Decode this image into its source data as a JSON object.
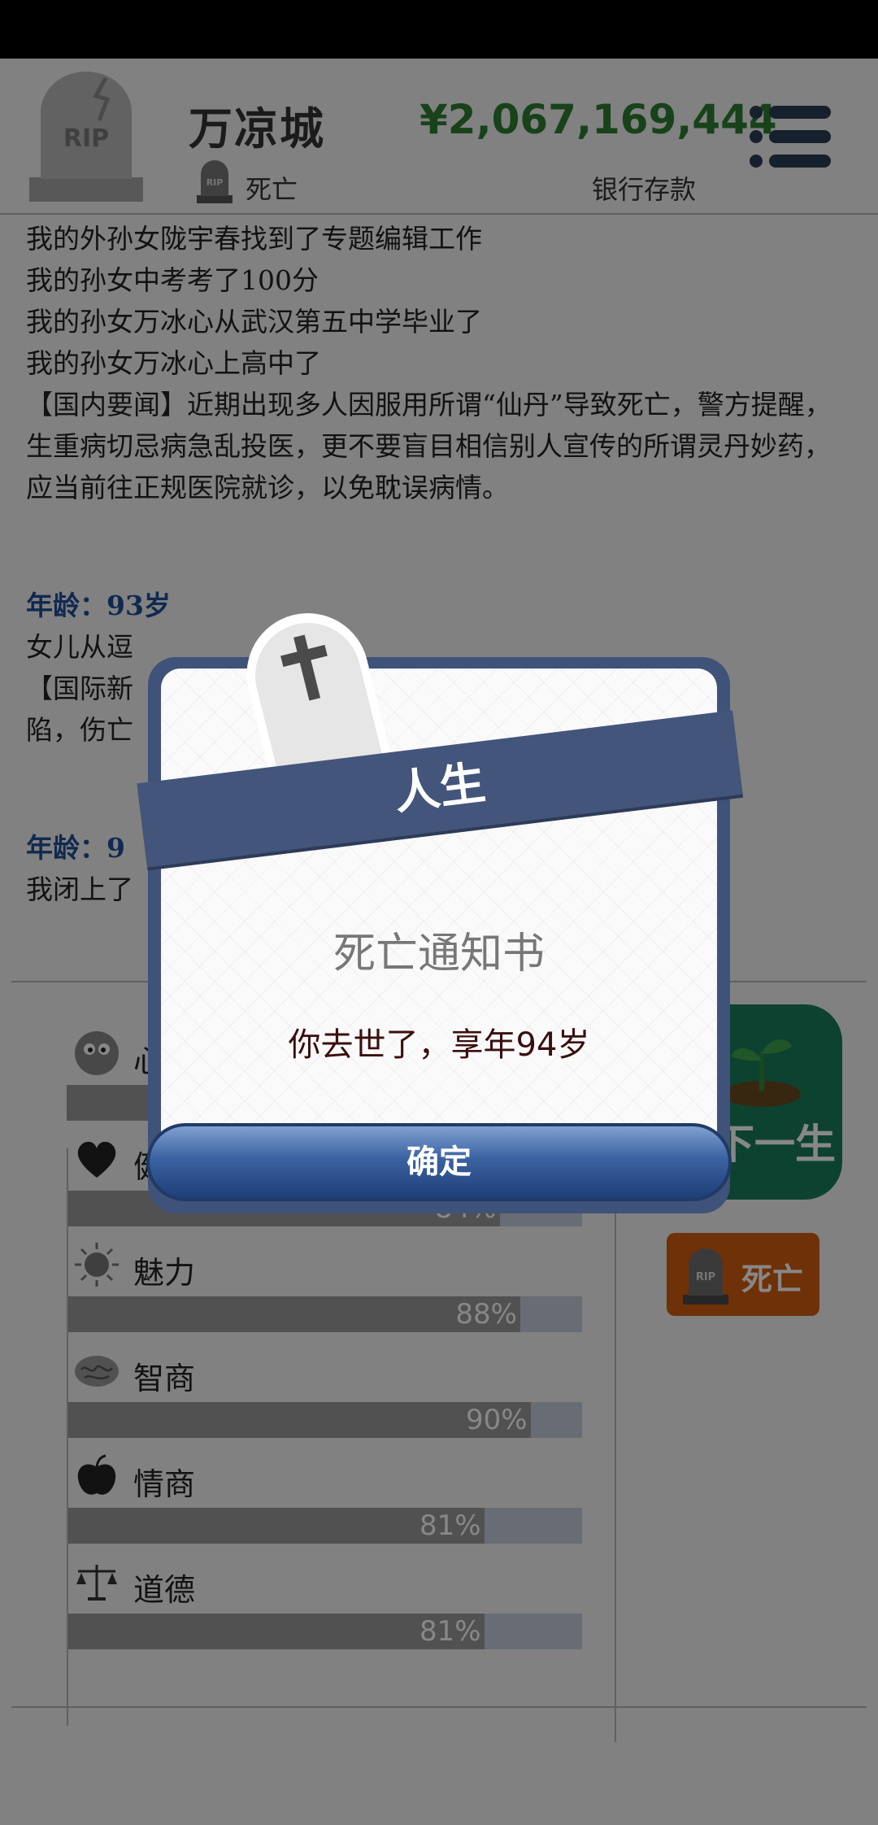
{
  "header": {
    "player_name": "万凉城",
    "status": "死亡",
    "money": "¥2,067,169,444",
    "money_label": "银行存款",
    "tombstone_text": "RIP"
  },
  "log": [
    {
      "type": "text",
      "text": "我的外孙女陇宇春找到了专题编辑工作"
    },
    {
      "type": "text",
      "text": "我的孙女中考考了100分"
    },
    {
      "type": "text",
      "text": "我的孙女万冰心从武汉第五中学毕业了"
    },
    {
      "type": "text",
      "text": "我的孙女万冰心上高中了"
    },
    {
      "type": "text",
      "text": "【国内要闻】近期出现多人因服用所谓“仙丹”导致死亡，警方提醒，生重病切忌病急乱投医，更不要盲目相信别人宣传的所谓灵丹妙药，应当前往正规医院就诊，以免耽误病情。"
    },
    {
      "type": "gap"
    },
    {
      "type": "age",
      "text": "年龄：93岁"
    },
    {
      "type": "text",
      "text": "女儿从逗"
    },
    {
      "type": "text",
      "text": "【国际新"
    },
    {
      "type": "text",
      "text": "陷，伤亡"
    },
    {
      "type": "gap"
    },
    {
      "type": "age",
      "text": "年龄：9"
    },
    {
      "type": "text",
      "text": "我闭上了"
    }
  ],
  "stats": [
    {
      "label": "心",
      "percent": 100,
      "icon": "smiley-face-icon"
    },
    {
      "label": "健",
      "percent": 84,
      "pct_text": "84%",
      "icon": "heart-icon"
    },
    {
      "label": "魅力",
      "percent": 88,
      "pct_text": "88%",
      "icon": "sun-icon"
    },
    {
      "label": "智商",
      "percent": 90,
      "pct_text": "90%",
      "icon": "brain-icon"
    },
    {
      "label": "情商",
      "percent": 81,
      "pct_text": "81%",
      "icon": "apple-icon"
    },
    {
      "label": "道德",
      "percent": 81,
      "pct_text": "81%",
      "icon": "scales-icon"
    }
  ],
  "side": {
    "next_life_label": "下一生",
    "death_label": "死亡"
  },
  "dialog": {
    "ribbon_title": "人生",
    "heading": "死亡通知书",
    "message": "你去世了，享年94岁",
    "confirm_label": "确定"
  },
  "colors": {
    "money_green": "#2e7d32",
    "age_blue": "#1f4f96",
    "next_button": "#1c7d5c",
    "death_badge": "#d15d10",
    "dialog_frame": "#3f5279"
  }
}
